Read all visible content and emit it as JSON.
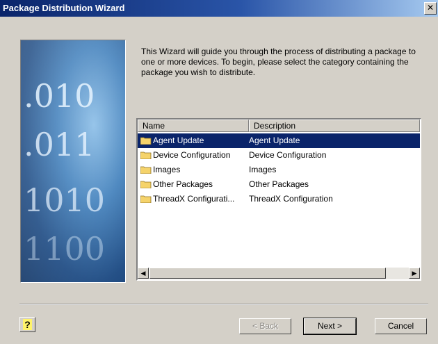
{
  "window": {
    "title": "Package Distribution Wizard",
    "close_label": "✕"
  },
  "intro": {
    "text": "This Wizard will guide you through the process of distributing a package to one or more devices.  To begin, please select the category containing the package you wish to distribute."
  },
  "banner": {
    "digits": [
      ".010",
      ".011",
      "1010",
      "1100"
    ]
  },
  "list": {
    "columns": [
      "Name",
      "Description"
    ],
    "rows": [
      {
        "name": "Agent Update",
        "description": "Agent Update",
        "selected": true
      },
      {
        "name": "Device Configuration",
        "description": "Device Configuration",
        "selected": false
      },
      {
        "name": "Images",
        "description": "Images",
        "selected": false
      },
      {
        "name": "Other Packages",
        "description": "Other Packages",
        "selected": false
      },
      {
        "name": "ThreadX Configurati...",
        "description": "ThreadX Configuration",
        "selected": false
      }
    ]
  },
  "buttons": {
    "help": "?",
    "back": "< Back",
    "next": "Next >",
    "cancel": "Cancel"
  },
  "colors": {
    "selection": "#0a246a",
    "folder": "#f5d36b",
    "titlebar": "#0a246a"
  }
}
